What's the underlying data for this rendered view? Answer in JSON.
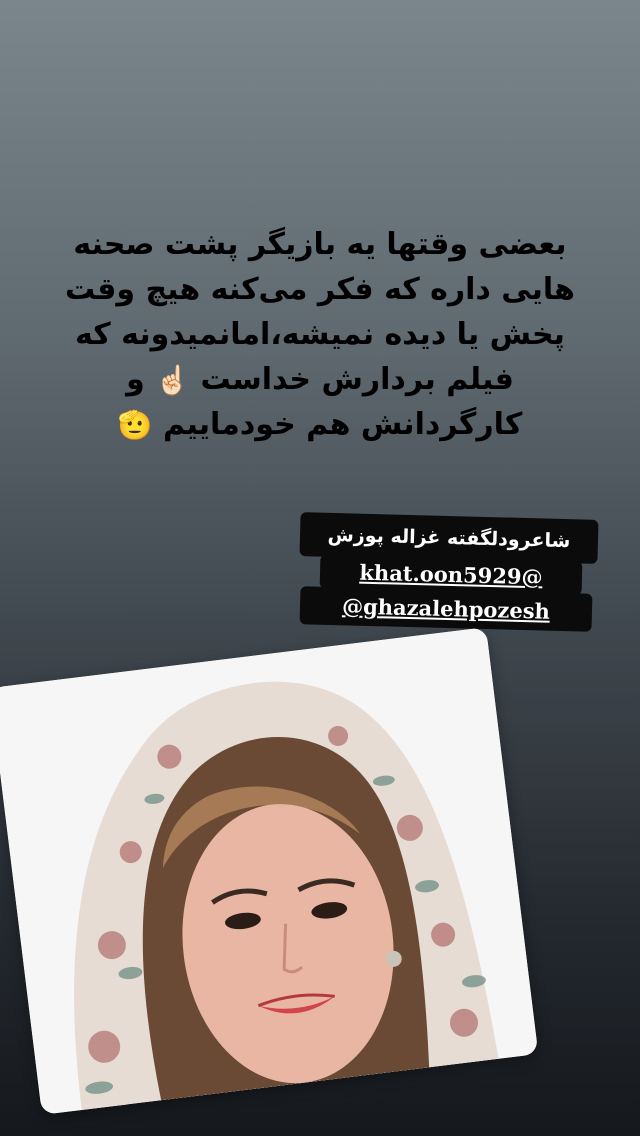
{
  "story": {
    "quote_lines": [
      "بعضی وقتها یه بازیگر پشت صحنه",
      "هایی داره که فکر می‌کنه هیچ وقت",
      "پخش یا دیده نمیشه،امانمیدونه که",
      "فیلم بردارش خداست",
      "کارگردانش هم خودماییم"
    ],
    "emoji_pointing": "☝🏻",
    "word_and": "و",
    "emoji_saluting": "🫡"
  },
  "tags": {
    "poet": "شاعرودلگفته غزاله پوزش",
    "handle_1": "khat.oon5929@",
    "handle_2": "@ghazalehpozesh"
  },
  "colors": {
    "background_top": "#7b868c",
    "background_bottom": "#15181c",
    "quote_text": "#000000",
    "tag_background": "#0b0b0b",
    "tag_text": "#ffffff",
    "card_background": "#f4f4f4"
  }
}
